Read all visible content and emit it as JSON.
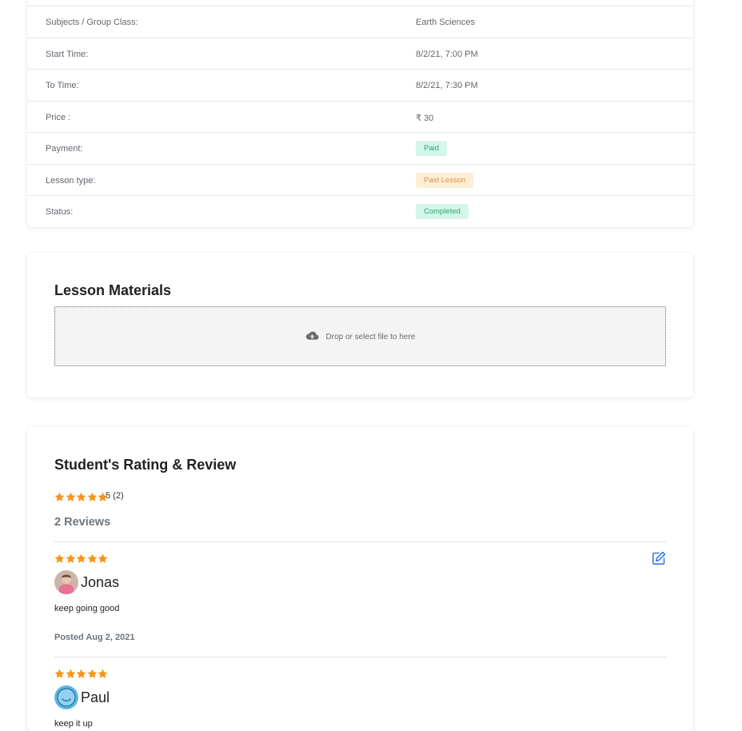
{
  "details": {
    "rows": [
      {
        "label": "Subjects / Group Class:",
        "value": "Earth Sciences"
      },
      {
        "label": "Start Time:",
        "value": "8/2/21, 7:00 PM"
      },
      {
        "label": "To Time:",
        "value": "8/2/21, 7:30 PM"
      },
      {
        "label": "Price :",
        "value": "₹ 30"
      },
      {
        "label": "Payment:",
        "value": "Paid"
      },
      {
        "label": "Lesson type:",
        "value": "Paid Lesson"
      },
      {
        "label": "Status:",
        "value": "Completed"
      }
    ]
  },
  "materials": {
    "title": "Lesson Materials",
    "dropzone_text": "Drop or select file to here",
    "icon": "cloud-upload-icon"
  },
  "reviews": {
    "title": "Student's Rating & Review",
    "summary": "5 (2)",
    "rating_stars": 5,
    "count_label": "2 Reviews",
    "items": [
      {
        "stars": 5,
        "name": "Jonas",
        "text": "keep going good",
        "posted": "Posted Aug 2, 2021"
      },
      {
        "stars": 5,
        "name": "Paul",
        "text": "keep it up"
      }
    ]
  },
  "colors": {
    "star": "#f7941d",
    "badge_green_bg": "#d5f6ea",
    "badge_green_text": "#2aa874",
    "badge_orange_bg": "#fdeed6",
    "badge_orange_text": "#e0904a",
    "edit_icon": "#2f7be5"
  }
}
